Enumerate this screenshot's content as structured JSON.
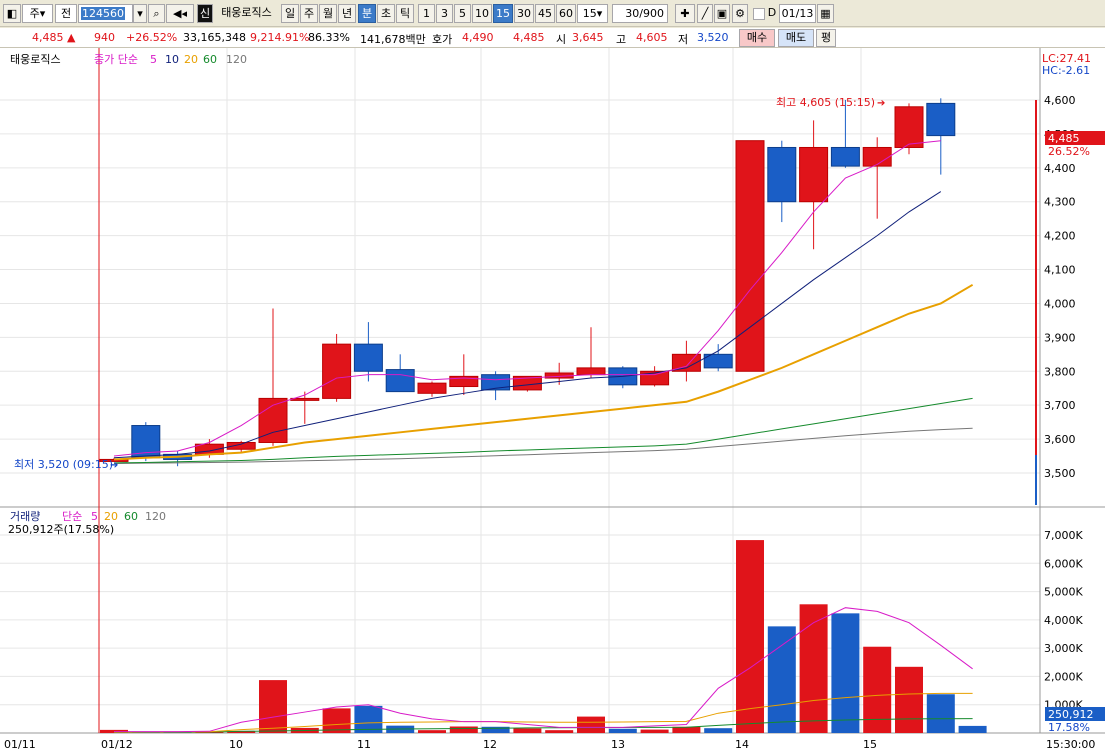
{
  "toolbar": {
    "market_label": "주",
    "type_label": "전",
    "code_value": "124560",
    "name": "태웅로직스",
    "new_badge": "신",
    "period_day": "일",
    "period_week": "주",
    "period_month": "월",
    "period_year": "년",
    "period_min": "분",
    "period_sec": "초",
    "period_tick": "틱",
    "intervals": [
      "1",
      "3",
      "5",
      "10",
      "15",
      "30",
      "45",
      "60"
    ],
    "interval_value": "15",
    "count_value": "30/900",
    "checkbox_label": "D",
    "date_value": "01/13",
    "colors": {
      "active": "#3c7bc8"
    }
  },
  "quote": {
    "price": "4,485",
    "arrow": "▲",
    "change": "940",
    "change_pct": "+26.52%",
    "volume": "33,165,348",
    "vol_ratio": "9,214.91%",
    "turnover_pct": "86.33%",
    "amount": "141,678백만",
    "hoga_label": "호가",
    "ask": "4,490",
    "bid": "4,485",
    "open_label": "시",
    "open": "3,645",
    "high_label": "고",
    "high": "4,605",
    "low_label": "저",
    "low": "3,520",
    "buy_label": "매수",
    "sell_label": "매도",
    "avg_label": "평"
  },
  "price_panel": {
    "stock_name": "태웅로직스",
    "ma_label": "종가 단순",
    "ma_periods": [
      "5",
      "10",
      "20",
      "60",
      "120"
    ],
    "lc": "LC:27.41",
    "hc": "HC:-2.61",
    "high_annot": "최고 4,605 (15:15)",
    "low_annot": "최저 3,520 (09:15)",
    "current_tag": "4,485",
    "current_pct": "26.52%"
  },
  "volume_panel": {
    "label": "거래량",
    "ma_label": "단순",
    "ma_periods": [
      "5",
      "20",
      "60",
      "120"
    ],
    "current": "250,912주(17.58%)",
    "current_tag": "250,912",
    "current_pct": "17.58%"
  },
  "chart_data": {
    "type": "candlestick",
    "price_ticks": [
      "4,600",
      "4,500",
      "4,400",
      "4,300",
      "4,200",
      "4,100",
      "4,000",
      "3,900",
      "3,800",
      "3,700",
      "3,600",
      "3,500"
    ],
    "volume_ticks": [
      "7,000K",
      "6,000K",
      "5,000K",
      "4,000K",
      "3,000K",
      "2,000K",
      "1,000K"
    ],
    "x_labels": [
      "01/11",
      "01/12",
      "10",
      "11",
      "12",
      "13",
      "14",
      "15",
      "15:30:00"
    ],
    "candles": [
      {
        "o": 3540,
        "h": 3545,
        "l": 3535,
        "c": 3540,
        "v": 110,
        "up": true
      },
      {
        "o": 3545,
        "h": 3650,
        "l": 3535,
        "c": 3640,
        "v": 30,
        "up": false
      },
      {
        "o": 3555,
        "h": 3565,
        "l": 3520,
        "c": 3540,
        "v": 40,
        "up": false
      },
      {
        "o": 3555,
        "h": 3600,
        "l": 3545,
        "c": 3585,
        "v": 50,
        "up": true
      },
      {
        "o": 3570,
        "h": 3595,
        "l": 3560,
        "c": 3590,
        "v": 60,
        "up": true
      },
      {
        "o": 3590,
        "h": 3985,
        "l": 3580,
        "c": 3720,
        "v": 1870,
        "up": true
      },
      {
        "o": 3720,
        "h": 3740,
        "l": 3645,
        "c": 3720,
        "v": 180,
        "up": true
      },
      {
        "o": 3720,
        "h": 3910,
        "l": 3710,
        "c": 3880,
        "v": 870,
        "up": true
      },
      {
        "o": 3880,
        "h": 3945,
        "l": 3770,
        "c": 3800,
        "v": 960,
        "up": false
      },
      {
        "o": 3805,
        "h": 3850,
        "l": 3740,
        "c": 3740,
        "v": 260,
        "up": false
      },
      {
        "o": 3735,
        "h": 3770,
        "l": 3725,
        "c": 3765,
        "v": 100,
        "up": true
      },
      {
        "o": 3755,
        "h": 3850,
        "l": 3730,
        "c": 3785,
        "v": 230,
        "up": true
      },
      {
        "o": 3790,
        "h": 3800,
        "l": 3715,
        "c": 3745,
        "v": 220,
        "up": false
      },
      {
        "o": 3745,
        "h": 3785,
        "l": 3740,
        "c": 3785,
        "v": 160,
        "up": true
      },
      {
        "o": 3780,
        "h": 3825,
        "l": 3760,
        "c": 3795,
        "v": 100,
        "up": true
      },
      {
        "o": 3790,
        "h": 3930,
        "l": 3780,
        "c": 3810,
        "v": 580,
        "up": true
      },
      {
        "o": 3810,
        "h": 3815,
        "l": 3750,
        "c": 3760,
        "v": 150,
        "up": false
      },
      {
        "o": 3760,
        "h": 3815,
        "l": 3755,
        "c": 3800,
        "v": 120,
        "up": true
      },
      {
        "o": 3800,
        "h": 3890,
        "l": 3770,
        "c": 3850,
        "v": 220,
        "up": true
      },
      {
        "o": 3850,
        "h": 3880,
        "l": 3800,
        "c": 3810,
        "v": 170,
        "up": false
      },
      {
        "o": 3800,
        "h": 4480,
        "l": 3800,
        "c": 4480,
        "v": 6820,
        "up": true
      },
      {
        "o": 4460,
        "h": 4480,
        "l": 4240,
        "c": 4300,
        "v": 3770,
        "up": false
      },
      {
        "o": 4300,
        "h": 4540,
        "l": 4160,
        "c": 4460,
        "v": 4550,
        "up": true
      },
      {
        "o": 4460,
        "h": 4600,
        "l": 4400,
        "c": 4405,
        "v": 4230,
        "up": false
      },
      {
        "o": 4405,
        "h": 4490,
        "l": 4250,
        "c": 4460,
        "v": 3050,
        "up": true
      },
      {
        "o": 4460,
        "h": 4590,
        "l": 4440,
        "c": 4580,
        "v": 2340,
        "up": true
      },
      {
        "o": 4590,
        "h": 4605,
        "l": 4380,
        "c": 4495,
        "v": 1370,
        "up": false
      },
      {
        "o": null,
        "h": null,
        "l": null,
        "c": null,
        "v": 251,
        "up": false
      }
    ],
    "ma_price": {
      "ma5": [
        3550,
        3560,
        3565,
        3590,
        3640,
        3700,
        3730,
        3780,
        3790,
        3790,
        3775,
        3780,
        3775,
        3780,
        3785,
        3790,
        3790,
        3790,
        3815,
        3920,
        4040,
        4150,
        4270,
        4370,
        4410,
        4470,
        4480
      ],
      "ma10": [
        3545,
        3550,
        3555,
        3565,
        3585,
        3620,
        3640,
        3660,
        3680,
        3700,
        3720,
        3735,
        3750,
        3760,
        3770,
        3780,
        3785,
        3795,
        3810,
        3860,
        3930,
        4000,
        4070,
        4135,
        4200,
        4270,
        4330
      ],
      "ma20": [
        3540,
        3545,
        3548,
        3555,
        3560,
        3575,
        3590,
        3600,
        3610,
        3620,
        3630,
        3640,
        3650,
        3660,
        3670,
        3680,
        3690,
        3700,
        3710,
        3740,
        3775,
        3810,
        3850,
        3890,
        3930,
        3970,
        4000,
        4055
      ],
      "ma60": [
        3530,
        3531,
        3533,
        3535,
        3537,
        3540,
        3545,
        3549,
        3552,
        3555,
        3558,
        3561,
        3565,
        3568,
        3571,
        3574,
        3577,
        3580,
        3585,
        3600,
        3615,
        3630,
        3645,
        3660,
        3675,
        3690,
        3705,
        3720
      ],
      "ma120": [
        3528,
        3529,
        3530,
        3531,
        3532,
        3534,
        3536,
        3538,
        3540,
        3542,
        3545,
        3548,
        3551,
        3554,
        3557,
        3560,
        3563,
        3566,
        3570,
        3578,
        3586,
        3594,
        3602,
        3610,
        3617,
        3623,
        3628,
        3632
      ]
    },
    "ma_volume": {
      "ma5": [
        50,
        50,
        50,
        60,
        380,
        560,
        740,
        920,
        1000,
        700,
        500,
        400,
        400,
        300,
        200,
        200,
        200,
        250,
        300,
        1580,
        2300,
        3100,
        3900,
        4430,
        4300,
        3900,
        3100,
        2270
      ],
      "ma20": [
        30,
        35,
        40,
        45,
        120,
        170,
        230,
        300,
        360,
        380,
        390,
        400,
        400,
        390,
        380,
        380,
        390,
        400,
        410,
        700,
        860,
        1000,
        1150,
        1250,
        1330,
        1380,
        1400,
        1400
      ],
      "ma60": [
        20,
        25,
        28,
        30,
        60,
        70,
        90,
        110,
        130,
        140,
        150,
        160,
        170,
        180,
        185,
        190,
        195,
        200,
        205,
        270,
        330,
        390,
        430,
        460,
        480,
        500,
        505,
        510
      ]
    },
    "colors": {
      "up": "#e0141a",
      "down": "#1a5ec6",
      "ma5": "#d81bc8",
      "ma10": "#10207a",
      "ma20": "#e8a000",
      "ma60": "#158a2c",
      "ma120": "#777777"
    }
  }
}
